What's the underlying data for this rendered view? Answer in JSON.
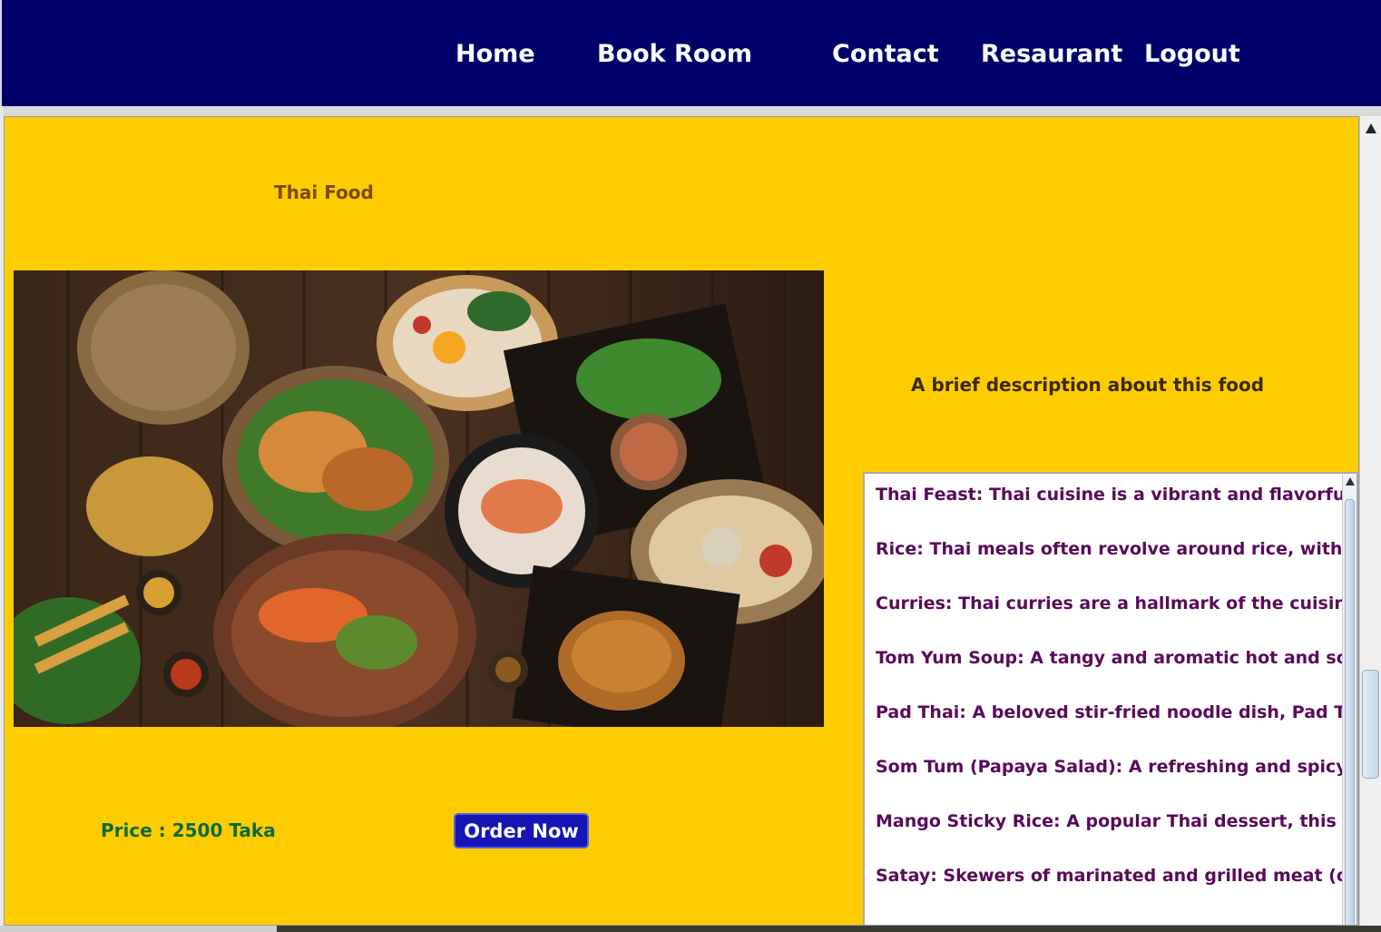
{
  "nav": {
    "items": [
      {
        "label": "Home"
      },
      {
        "label": "Book Room"
      },
      {
        "label": "Contact"
      },
      {
        "label": "Resaurant"
      },
      {
        "label": "Logout"
      }
    ]
  },
  "food": {
    "title": "Thai Food",
    "image_icon": "thai-food-platter-image",
    "price": "Price : 2500 Taka",
    "order_label": "Order Now"
  },
  "description": {
    "heading": "A brief description about this food",
    "lines": [
      "Thai Feast: Thai cuisine is a vibrant and flavorful jou",
      "Rice: Thai meals often revolve around rice, with jasm",
      "Curries: Thai curries are a hallmark of the cuisine. Gr",
      "Tom Yum Soup: A tangy and aromatic hot and sour",
      "Pad Thai: A beloved stir-fried noodle dish, Pad Thai",
      "Som Tum (Papaya Salad): A refreshing and spicy sala",
      "Mango Sticky Rice: A popular Thai dessert, this dish",
      "Satay: Skewers of marinated and grilled meat (often"
    ]
  },
  "colors": {
    "nav_bg": "#00006b",
    "content_bg": "#ffcc00",
    "button_bg": "#1515b8",
    "desc_text": "#5a0a5a",
    "price_text": "#0d6b3a"
  }
}
